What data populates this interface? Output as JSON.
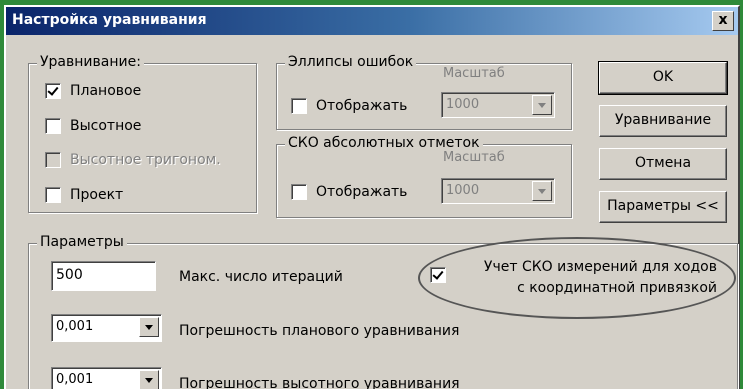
{
  "window": {
    "title": "Настройка уравнивания",
    "close_label": "x"
  },
  "adjustment": {
    "legend": "Уравнивание:",
    "options": [
      {
        "label": "Плановое",
        "checked": true,
        "disabled": false
      },
      {
        "label": "Высотное",
        "checked": false,
        "disabled": false
      },
      {
        "label": "Высотное тригоном.",
        "checked": false,
        "disabled": true
      },
      {
        "label": "Проект",
        "checked": false,
        "disabled": false
      }
    ]
  },
  "error_ellipses": {
    "legend": "Эллипсы ошибок",
    "scale_label": "Масштаб",
    "show_label": "Отображать",
    "show_checked": false,
    "scale_value": "1000"
  },
  "abs_elevation_rmse": {
    "legend": "СКО абсолютных отметок",
    "scale_label": "Масштаб",
    "show_label": "Отображать",
    "show_checked": false,
    "scale_value": "1000"
  },
  "buttons": {
    "ok": "OK",
    "adjust": "Уравнивание",
    "cancel": "Отмена",
    "params": "Параметры <<"
  },
  "parameters": {
    "legend": "Параметры",
    "max_iterations_value": "500",
    "max_iterations_label": "Макс. число итераций",
    "plan_error_value": "0,001",
    "plan_error_label": "Погрешность планового уравнивания",
    "height_error_value": "0,001",
    "height_error_label": "Погрешность высотного уравнивания",
    "rmse_option": {
      "line1": "Учет СКО измерений для ходов",
      "line2": "с координатной привязкой",
      "checked": true
    }
  }
}
